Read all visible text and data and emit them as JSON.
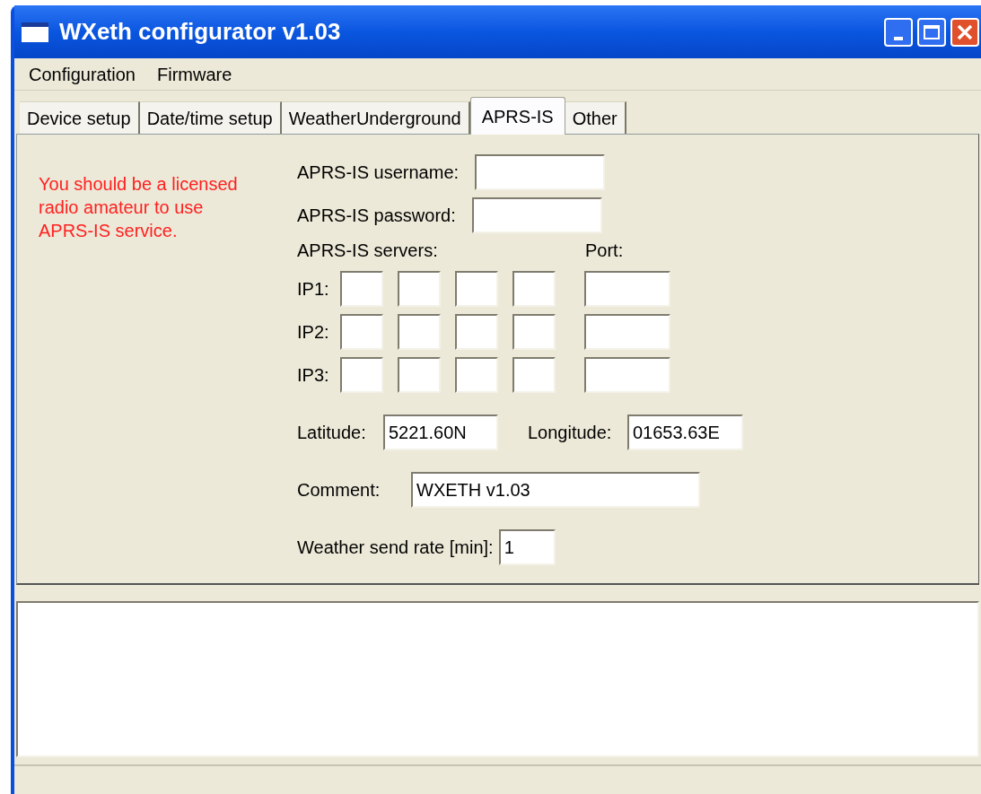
{
  "window": {
    "title": "WXeth configurator v1.03"
  },
  "menu": [
    "Configuration",
    "Firmware"
  ],
  "tabs": [
    {
      "label": "Device setup",
      "selected": false
    },
    {
      "label": "Date/time setup",
      "selected": false
    },
    {
      "label": "WeatherUnderground",
      "selected": false
    },
    {
      "label": "APRS-IS",
      "selected": true
    },
    {
      "label": "Other",
      "selected": false
    }
  ],
  "warning": "You should be a licensed radio amateur to use APRS-IS service.",
  "username": {
    "label": "APRS-IS username:"
  },
  "password": {
    "label": "APRS-IS password:"
  },
  "servers": {
    "label": "APRS-IS servers:",
    "port_label": "Port:",
    "rows": [
      {
        "label": "IP1:"
      },
      {
        "label": "IP2:"
      },
      {
        "label": "IP3:"
      }
    ]
  },
  "latitude": {
    "label": "Latitude:",
    "value": "5221.60N"
  },
  "longitude": {
    "label": "Longitude:",
    "value": "01653.63E"
  },
  "comment": {
    "label": "Comment:",
    "value": "WXETH v1.03"
  },
  "send_rate": {
    "label": "Weather send rate [min]:",
    "value": "1"
  }
}
